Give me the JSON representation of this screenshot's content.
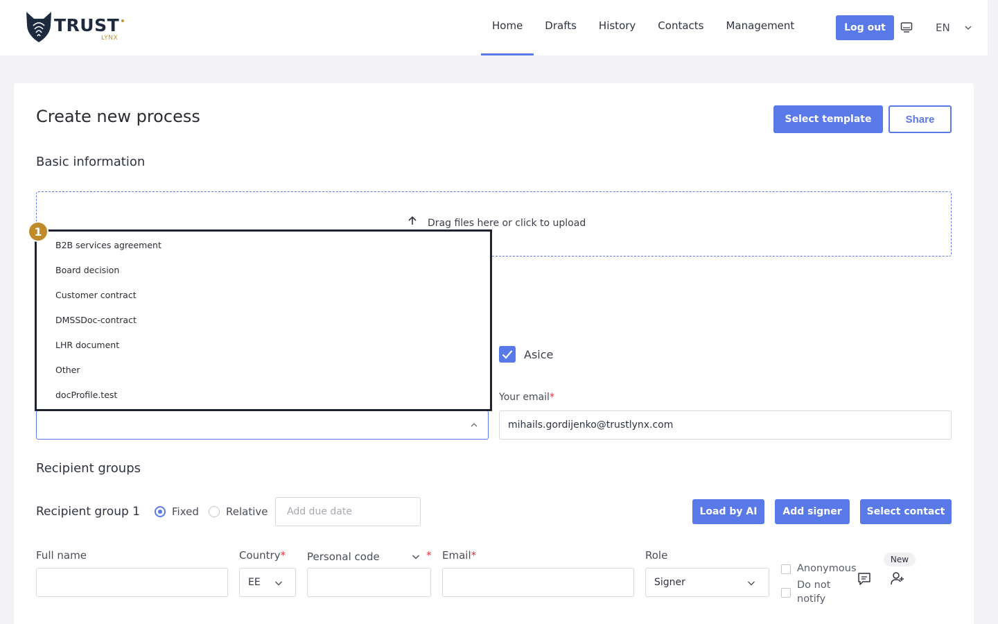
{
  "header": {
    "logo": {
      "main": "TRUST",
      "sub": "LYNX"
    },
    "nav": [
      "Home",
      "Drafts",
      "History",
      "Contacts",
      "Management"
    ],
    "active_nav": "Home",
    "logout_label": "Log out",
    "language": "EN"
  },
  "page": {
    "title": "Create new process",
    "select_template_label": "Select template",
    "share_label": "Share",
    "basic_info_title": "Basic information",
    "upload_text": "Drag files here or click to upload",
    "asice_label": "Asice",
    "your_email_label": "Your email",
    "your_email_value": "mihails.gordijenko@trustlynx.com"
  },
  "dropdown": {
    "badge": "1",
    "items": [
      "B2B services agreement",
      "Board decision",
      "Customer contract",
      "DMSSDoc-contract",
      "LHR document",
      "Other",
      "docProfile.test"
    ]
  },
  "recipients": {
    "section_title": "Recipient groups",
    "group_title": "Recipient group 1",
    "fixed_label": "Fixed",
    "relative_label": "Relative",
    "due_date_placeholder": "Add due date",
    "load_ai_label": "Load by AI",
    "add_signer_label": "Add signer",
    "select_contact_label": "Select contact",
    "full_name_label": "Full name",
    "country_label": "Country",
    "country_value": "EE",
    "personal_code_label": "Personal code",
    "email_label": "Email",
    "role_label": "Role",
    "role_value": "Signer",
    "anonymous_label": "Anonymous",
    "do_not_notify_line1": "Do not",
    "do_not_notify_line2": "notify",
    "new_label": "New",
    "required_mark": "*"
  },
  "colors": {
    "accent": "#5a79e8",
    "brand_gold": "#c8922a",
    "required": "#e0343f"
  }
}
